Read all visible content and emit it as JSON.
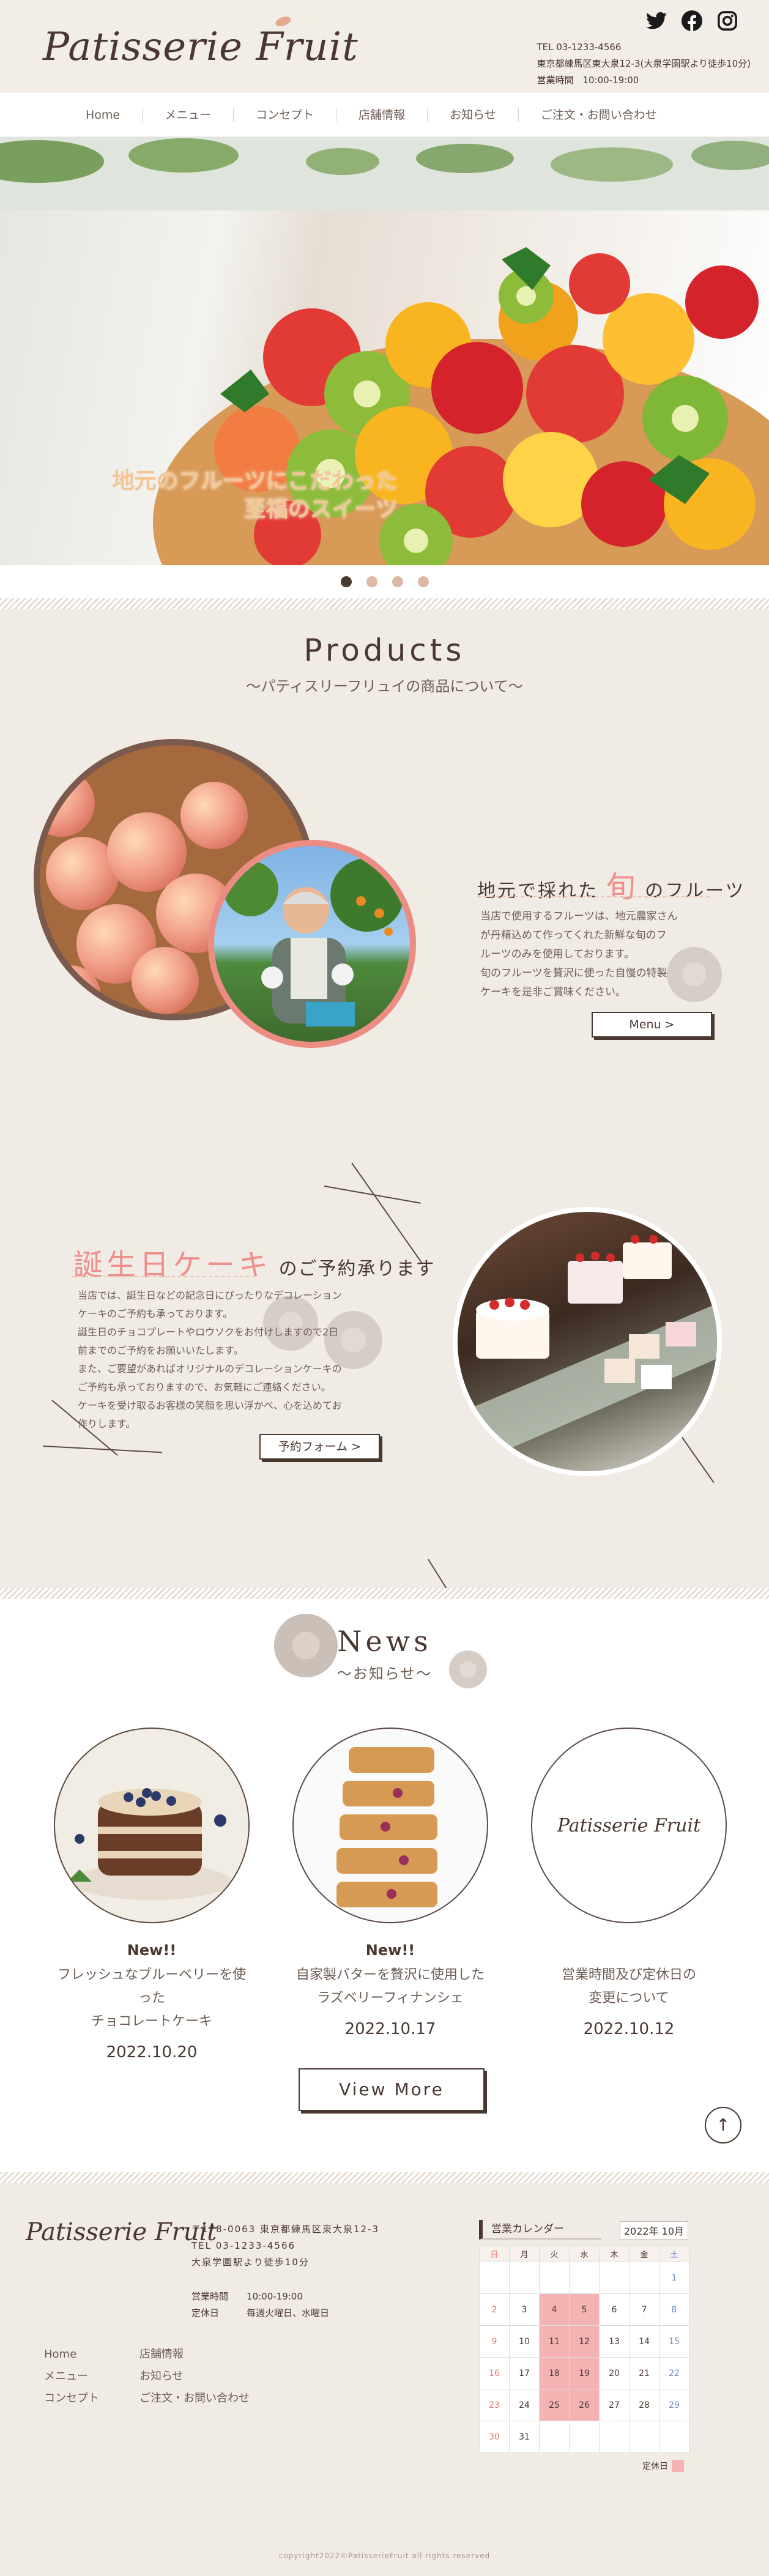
{
  "brand": {
    "logo": "Patisserie Fruit",
    "accent_color": "#ef8f8b",
    "dark_color": "#4a3730",
    "beige_color": "#f1ebe5"
  },
  "header": {
    "tel": "TEL 03-1233-4566",
    "address": "東京都練馬区東大泉12-3(大泉学園駅より徒歩10分)",
    "hours": "営業時間　10:00-19:00",
    "social": [
      "twitter-icon",
      "facebook-icon",
      "instagram-icon"
    ]
  },
  "nav": [
    "Home",
    "メニュー",
    "コンセプト",
    "店舗情報",
    "お知らせ",
    "ご注文・お問い合わせ"
  ],
  "hero": {
    "line1": "地元のフルーツにこだわった",
    "line2": "至福のスイーツ",
    "slides": 4,
    "active_slide": 1
  },
  "products": {
    "title": "Products",
    "subtitle": "〜パティスリーフリュイの商品について〜",
    "feature1": {
      "title_pre": "地元で採れた",
      "title_accent": "旬",
      "title_post": "のフルーツ",
      "lines": [
        "当店で使用するフルーツは、地元農家さん",
        "が丹精込めて作ってくれた新鮮な旬のフ",
        "ルーツのみを使用しております。",
        "旬のフルーツを贅沢に使った自慢の特製",
        "ケーキを是非ご賞味ください。"
      ],
      "button": "Menu >"
    },
    "feature2": {
      "title_accent": "誕生日ケーキ",
      "title_post": "のご予約承ります",
      "lines": [
        "当店では、誕生日などの記念日にぴったりなデコレーション",
        "ケーキのご予約も承っております。",
        "誕生日のチョコプレートやロウソクをお付けしますので2日",
        "前までのご予約をお願いいたします。",
        "また、ご要望があればオリジナルのデコレーションケーキの",
        "ご予約も承っておりますので、お気軽にご連絡ください。",
        "ケーキを受け取るお客様の笑顔を思い浮かべ、心を込めてお",
        "作りします。"
      ],
      "button": "予約フォーム >"
    }
  },
  "news": {
    "title": "News",
    "subtitle": "〜お知らせ〜",
    "items": [
      {
        "badge": "New!!",
        "line1": "フレッシュなブルーベリーを使った",
        "line2": "チョコレートケーキ",
        "date": "2022.10.20"
      },
      {
        "badge": "New!!",
        "line1": "自家製バターを贅沢に使用した",
        "line2": "ラズベリーフィナンシェ",
        "date": "2022.10.17"
      },
      {
        "badge": "",
        "line1": "営業時間及び定休日の",
        "line2": "変更について",
        "date": "2022.10.12",
        "logo": "Patisserie Fruit"
      }
    ],
    "view_more": "View More",
    "to_top": "↑"
  },
  "footer": {
    "logo": "Patisserie Fruit",
    "postal": "〒178-0063 東京都練馬区東大泉12-3",
    "tel": "TEL 03-1233-4566",
    "access": "大泉学園駅より徒歩10分",
    "hours_label": "営業時間",
    "hours": "10:00-19:00",
    "closed_label": "定休日",
    "closed": "毎週火曜日、水曜日",
    "links_col1": [
      "Home",
      "メニュー",
      "コンセプト"
    ],
    "links_col2": [
      "店舗情報",
      "お知らせ",
      "ご注文・お問い合わせ"
    ],
    "calendar": {
      "title": "営業カレンダー",
      "month": "2022年 10月",
      "weekdays": [
        "日",
        "月",
        "火",
        "水",
        "木",
        "金",
        "土"
      ],
      "weeks": [
        [
          "",
          "",
          "",
          "",
          "",
          "",
          "1"
        ],
        [
          "2",
          "3",
          "4",
          "5",
          "6",
          "7",
          "8"
        ],
        [
          "9",
          "10",
          "11",
          "12",
          "13",
          "14",
          "15"
        ],
        [
          "16",
          "17",
          "18",
          "19",
          "20",
          "21",
          "22"
        ],
        [
          "23",
          "24",
          "25",
          "26",
          "27",
          "28",
          "29"
        ],
        [
          "30",
          "31",
          "",
          "",
          "",
          "",
          ""
        ]
      ],
      "closed_days": [
        "4",
        "5",
        "11",
        "12",
        "18",
        "19",
        "25",
        "26"
      ],
      "legend": "定休日"
    },
    "copyright": "copyright2022©PatisserieFruit all rights reserved"
  }
}
